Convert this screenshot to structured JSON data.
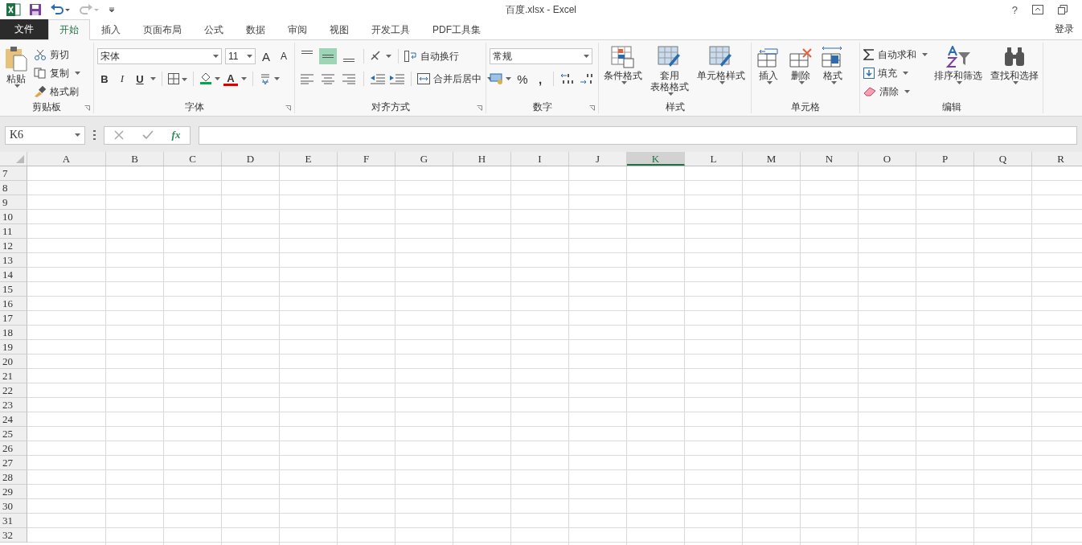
{
  "title_bar": {
    "title": "百度.xlsx - Excel",
    "help": "?"
  },
  "file_tab": "文件",
  "tabs": [
    {
      "label": "开始",
      "selected": true
    },
    {
      "label": "插入",
      "selected": false
    },
    {
      "label": "页面布局",
      "selected": false
    },
    {
      "label": "公式",
      "selected": false
    },
    {
      "label": "数据",
      "selected": false
    },
    {
      "label": "审阅",
      "selected": false
    },
    {
      "label": "视图",
      "selected": false
    },
    {
      "label": "开发工具",
      "selected": false
    },
    {
      "label": "PDF工具集",
      "selected": false
    }
  ],
  "sign_in": "登录",
  "ribbon": {
    "clipboard": {
      "paste": "粘贴",
      "cut": "剪切",
      "copy": "复制",
      "format_painter": "格式刷",
      "label": "剪贴板"
    },
    "font": {
      "font_name": "宋体",
      "font_size": "11",
      "grow": "A",
      "shrink": "A",
      "bold": "B",
      "italic": "I",
      "underline": "U",
      "font_color": "A",
      "label": "字体"
    },
    "alignment": {
      "vertical": [
        {
          "selected": false
        },
        {
          "selected": true
        },
        {
          "selected": false
        }
      ],
      "wrap_text": "自动换行",
      "merge_center": "合并后居中",
      "label": "对齐方式"
    },
    "number": {
      "format": "常规",
      "percent": "%",
      "comma": ",",
      "label": "数字"
    },
    "styles": {
      "buttons": [
        [
          "条件格式"
        ],
        [
          "套用",
          "表格格式"
        ],
        [
          "单元格样式"
        ]
      ],
      "label": "样式"
    },
    "cells": {
      "buttons": [
        "插入",
        "删除",
        "格式"
      ],
      "label": "单元格"
    },
    "editing": {
      "autosum": "自动求和",
      "fill": "填充",
      "clear": "清除",
      "sort_filter": "排序和筛选",
      "find_select": "查找和选择",
      "label": "编辑"
    }
  },
  "formula_bar": {
    "name_box": "K6",
    "function_label": "fx"
  },
  "sheet": {
    "columns": [
      {
        "label": "A",
        "selected": false
      },
      {
        "label": "B",
        "selected": false
      },
      {
        "label": "C",
        "selected": false
      },
      {
        "label": "D",
        "selected": false
      },
      {
        "label": "E",
        "selected": false
      },
      {
        "label": "F",
        "selected": false
      },
      {
        "label": "G",
        "selected": false
      },
      {
        "label": "H",
        "selected": false
      },
      {
        "label": "I",
        "selected": false
      },
      {
        "label": "J",
        "selected": false
      },
      {
        "label": "K",
        "selected": true
      },
      {
        "label": "L",
        "selected": false
      },
      {
        "label": "M",
        "selected": false
      },
      {
        "label": "N",
        "selected": false
      },
      {
        "label": "O",
        "selected": false
      },
      {
        "label": "P",
        "selected": false
      },
      {
        "label": "Q",
        "selected": false
      },
      {
        "label": "R",
        "selected": false
      }
    ],
    "rows": [
      "7",
      "8",
      "9",
      "10",
      "11",
      "12",
      "13",
      "14",
      "15",
      "16",
      "17",
      "18",
      "19",
      "20",
      "21",
      "22",
      "23",
      "24",
      "25",
      "26",
      "27",
      "28",
      "29",
      "30",
      "31",
      "32"
    ]
  }
}
